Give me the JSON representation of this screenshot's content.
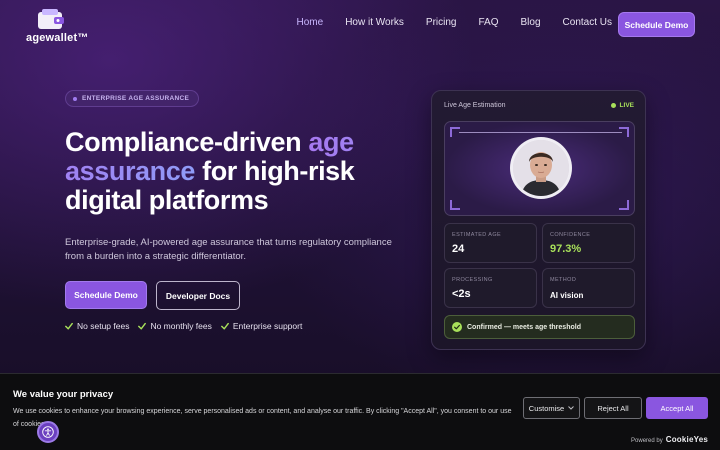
{
  "brand": {
    "name": "agewallet™"
  },
  "nav": {
    "links": [
      "Home",
      "How it Works",
      "Pricing",
      "FAQ",
      "Blog",
      "Contact Us"
    ],
    "cta": "Schedule Demo"
  },
  "hero": {
    "badge": "ENTERPRISE AGE ASSURANCE",
    "headline_part1": "Compliance-driven ",
    "headline_accent": "age assurance",
    "headline_part2": " for high-risk digital platforms",
    "subtext": "Enterprise-grade, AI-powered age assurance that turns regulatory compliance from a burden into a strategic differentiator.",
    "primary_button": "Schedule Demo",
    "secondary_button": "Developer Docs",
    "checks": [
      "No setup fees",
      "No monthly fees",
      "Enterprise support"
    ]
  },
  "card": {
    "title": "Live Age Estimation",
    "live_label": "LIVE",
    "stats": [
      {
        "label": "ESTIMATED AGE",
        "value": "24"
      },
      {
        "label": "CONFIDENCE",
        "value": "97.3%"
      },
      {
        "label": "PROCESSING",
        "value": "<2s"
      },
      {
        "label": "METHOD",
        "value": "AI vision"
      }
    ],
    "confirm": "Confirmed — meets age threshold"
  },
  "cookie": {
    "title": "We value your privacy",
    "text": "We use cookies to enhance your browsing experience, serve personalised ads or content, and analyse our traffic. By clicking \"Accept All\", you consent to our use of cookies.",
    "customise": "Customise",
    "reject": "Reject All",
    "accept": "Accept All",
    "powered_by": "Powered by",
    "powered_brand": "CookieYes"
  },
  "colors": {
    "accent": "#8a56e0",
    "live": "#a8e05a",
    "banner_bg": "#0d0d0f"
  },
  "icons": [
    "wallet-logo-icon",
    "check-icon",
    "live-dot-icon",
    "confirm-check-icon",
    "chevron-down-icon",
    "accessibility-icon"
  ]
}
